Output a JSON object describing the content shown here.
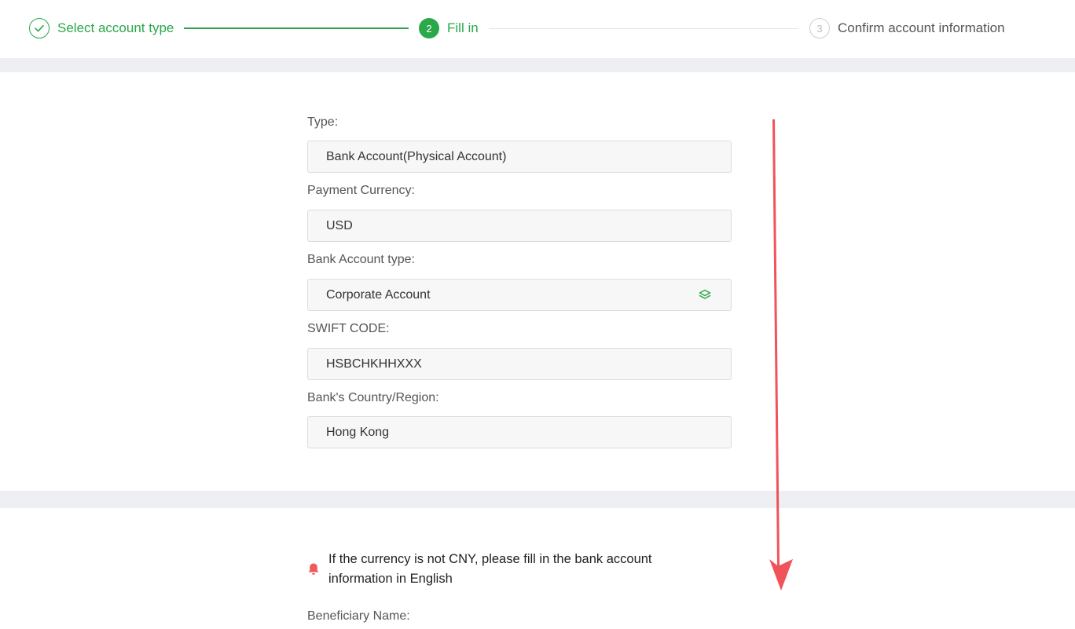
{
  "stepper": {
    "steps": [
      {
        "number": "1",
        "label": "Select account type"
      },
      {
        "number": "2",
        "label": "Fill in"
      },
      {
        "number": "3",
        "label": "Confirm account information"
      }
    ]
  },
  "form": {
    "type": {
      "label": "Type:",
      "value": "Bank Account(Physical Account)"
    },
    "payment_currency": {
      "label": "Payment Currency:",
      "value": "USD"
    },
    "bank_account_type": {
      "label": "Bank Account type:",
      "value": "Corporate Account"
    },
    "swift_code": {
      "label": "SWIFT CODE:",
      "value": "HSBCHKHHXXX"
    },
    "bank_country": {
      "label": "Bank's Country/Region:",
      "value": "Hong Kong"
    }
  },
  "notice": {
    "text": "If the currency is not CNY, please fill in the bank account information in English"
  },
  "beneficiary": {
    "label": "Beneficiary Name:"
  },
  "colors": {
    "accent": "#2aa84a",
    "notice_icon": "#f05a5a",
    "annotation_arrow": "#f0535a",
    "separator": "#eeeff3"
  }
}
